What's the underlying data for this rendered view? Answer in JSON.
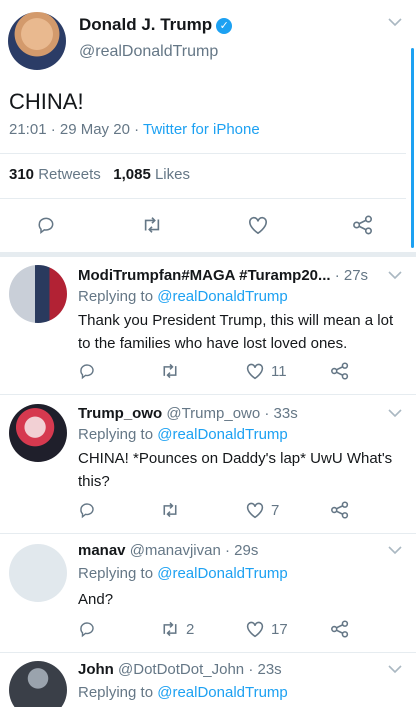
{
  "main": {
    "name": "Donald J. Trump",
    "handle": "@realDonaldTrump",
    "text": "CHINA!",
    "time": "21:01 · 29 May 20",
    "dot": " · ",
    "source": "Twitter for iPhone",
    "retweets_count": "310",
    "retweets_label": "Retweets",
    "likes_count": "1,085",
    "likes_label": "Likes"
  },
  "replies": [
    {
      "name": "ModiTrumpfan#MAGA #Turamp20...",
      "handle": "",
      "time": "· 27s",
      "replying_prefix": "Replying to ",
      "replying_to": "@realDonaldTrump",
      "text": "Thank you President Trump, this will mean a lot to the families who have lost loved ones.",
      "retweets": "",
      "likes": "11"
    },
    {
      "name": "Trump_owo",
      "handle": "@Trump_owo",
      "time": "· 33s",
      "replying_prefix": "Replying to ",
      "replying_to": "@realDonaldTrump",
      "text": "CHINA! *Pounces on Daddy's lap* UwU What's this?",
      "retweets": "",
      "likes": "7"
    },
    {
      "name": "manav",
      "handle": "@manavjivan",
      "time": "· 29s",
      "replying_prefix": "Replying to ",
      "replying_to": "@realDonaldTrump",
      "text": "And?",
      "retweets": "2",
      "likes": "17"
    },
    {
      "name": "John",
      "handle": "@DotDotDot_John",
      "time": "· 23s",
      "replying_prefix": "Replying to ",
      "replying_to": "@realDonaldTrump",
      "text": "",
      "retweets": "",
      "likes": ""
    }
  ],
  "icons": {
    "reply": "reply-icon",
    "retweet": "retweet-icon",
    "like": "heart-icon",
    "share": "share-icon",
    "more": "chevron-down-icon",
    "verified": "verified-badge-icon"
  },
  "colors": {
    "accent": "#1da1f2",
    "muted": "#657786",
    "text": "#14171a",
    "divider": "#e6ecf0"
  }
}
